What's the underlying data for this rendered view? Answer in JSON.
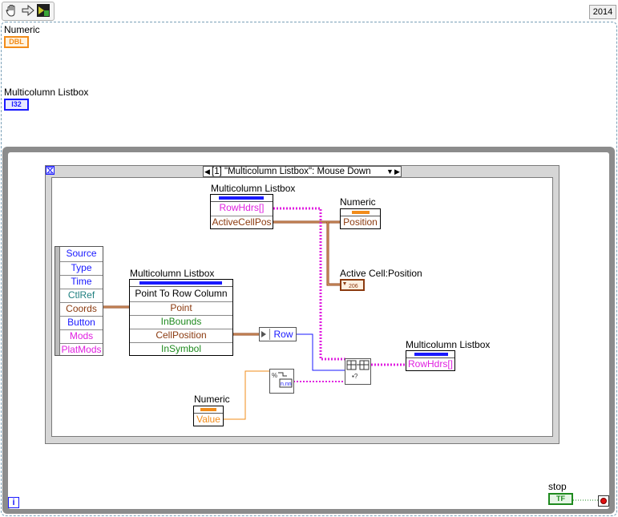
{
  "toolbar": {
    "version": "2014"
  },
  "controls": {
    "numeric_label": "Numeric",
    "numeric_terminal": "DBL",
    "listbox_label": "Multicolumn Listbox",
    "listbox_terminal": "I32",
    "stop_label": "stop",
    "stop_terminal": "TF"
  },
  "event_structure": {
    "selector": "[1] \"Multicolumn Listbox\": Mouse Down",
    "event_data_items": [
      "Source",
      "Type",
      "Time",
      "CtlRef",
      "Coords",
      "Button",
      "Mods",
      "PlatMods"
    ]
  },
  "property_node_top": {
    "label": "Multicolumn Listbox",
    "items": [
      "RowHdrs[]",
      "ActiveCellPos"
    ]
  },
  "invoke_node": {
    "label": "Multicolumn Listbox",
    "method": "Point To Row Column",
    "items": [
      "Point",
      "InBounds",
      "CellPosition",
      "InSymbol"
    ]
  },
  "unbundle": {
    "item": "Row"
  },
  "property_node_numeric": {
    "label": "Numeric",
    "item": "Position"
  },
  "active_cell": {
    "label": "Active Cell:Position"
  },
  "numeric_value_node": {
    "label": "Numeric",
    "item": "Value"
  },
  "property_node_right": {
    "label": "Multicolumn Listbox",
    "item": "RowHdrs[]"
  },
  "loop": {
    "iteration": "i"
  },
  "colors": {
    "dbl": "#f28c1a",
    "i32": "#1a1aff",
    "string": "#e020e0",
    "cluster": "#8b3a0f",
    "bool": "#1e8a1e"
  }
}
